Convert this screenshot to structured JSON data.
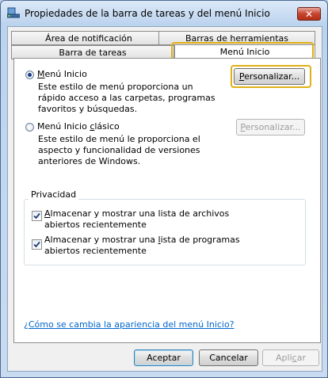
{
  "window": {
    "title": "Propiedades de la barra de tareas y del menú Inicio",
    "close_glyph": "✕",
    "icon": "taskbar-app-icon"
  },
  "tabs": {
    "row_back": [
      "Área de notificación",
      "Barras de herramientas"
    ],
    "row_front": [
      "Barra de tareas",
      "Menú Inicio"
    ],
    "active": "Menú Inicio"
  },
  "start_menu": {
    "option_label": "Menú Inicio",
    "option_desc": "Este estilo de menú proporciona un rápido acceso a las carpetas, programas favoritos y búsquedas.",
    "customize_label": "Personalizar...",
    "classic_label": "Menú Inicio clásico",
    "classic_desc": "Este estilo de menú le proporciona el aspecto y funcionalidad de versiones anteriores de Windows.",
    "classic_customize_label": "Personalizar..."
  },
  "privacy": {
    "title": "Privacidad",
    "files_label": "Almacenar y mostrar una lista de archivos abiertos recientemente",
    "programs_label": "Almacenar y mostrar una lista de programas abiertos recientemente"
  },
  "help_link": "¿Cómo se cambia la apariencia del menú Inicio?",
  "footer": {
    "ok": "Aceptar",
    "cancel": "Cancelar",
    "apply": "Aplicar"
  },
  "colors": {
    "highlight": "#e0b014",
    "link": "#0066cc"
  }
}
